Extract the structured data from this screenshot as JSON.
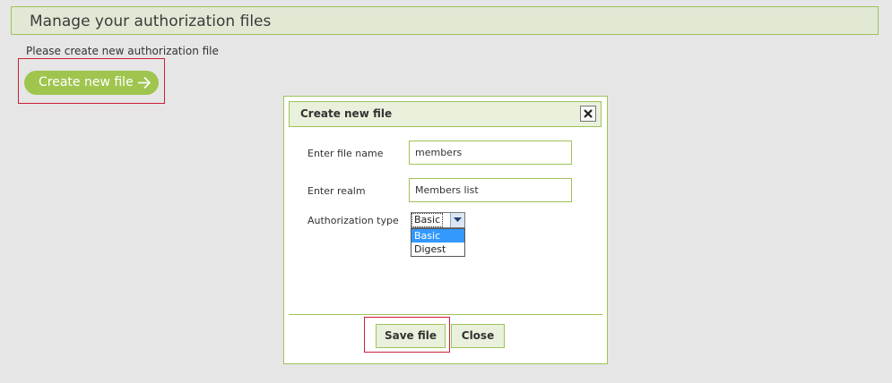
{
  "header": {
    "title": "Manage your authorization files"
  },
  "intro": {
    "text": "Please create new authorization file"
  },
  "create_button": {
    "label": "Create new file",
    "icon": "arrow-right-icon"
  },
  "dialog": {
    "title": "Create new file",
    "close_icon": "close-icon",
    "fields": {
      "file_name": {
        "label": "Enter file name",
        "value": "members"
      },
      "realm": {
        "label": "Enter realm",
        "value": "Members list"
      },
      "auth_type": {
        "label": "Authorization type",
        "selected": "Basic",
        "options": [
          "Basic",
          "Digest"
        ],
        "highlighted_option": "Basic"
      }
    },
    "buttons": {
      "save_label": "Save file",
      "close_label": "Close"
    }
  },
  "colors": {
    "page_background": "#e6e6e6",
    "accent_green": "#9fc54f",
    "panel_green_light": "#e9f1dc",
    "border_green": "#9fc25a",
    "highlight_red": "#cc1f3a",
    "dropdown_selected": "#3399ff"
  }
}
